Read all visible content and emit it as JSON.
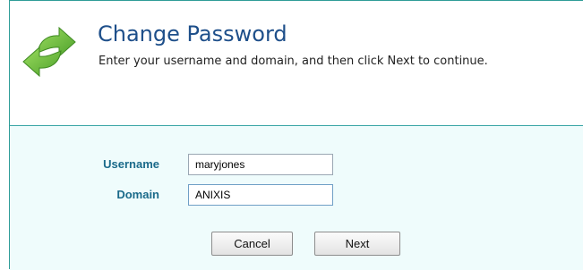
{
  "header": {
    "title": "Change Password",
    "subtitle": "Enter your username and domain, and then click Next to continue.",
    "logo_icon": "green-refresh-arrows-icon"
  },
  "form": {
    "username_label": "Username",
    "username_value": "maryjones",
    "domain_label": "Domain",
    "domain_value": "ANIXIS"
  },
  "buttons": {
    "cancel_label": "Cancel",
    "next_label": "Next"
  },
  "colors": {
    "accent": "#2f9d98",
    "title": "#1e4f8a",
    "label": "#1a6a8a",
    "content_background": "#effcfc",
    "icon_green": "#6cbf3d"
  }
}
